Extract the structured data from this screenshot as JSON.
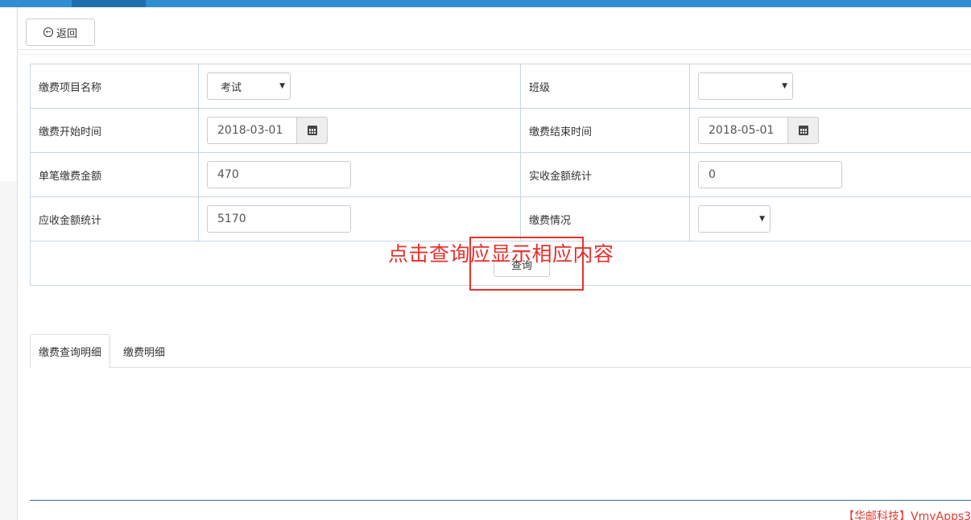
{
  "toolbar": {
    "back_label": "返回"
  },
  "form": {
    "rows": [
      {
        "label1": "缴费项目名称",
        "value1": "考试",
        "label2": "班级",
        "value2": ""
      },
      {
        "label1": "缴费开始时间",
        "value1": "2018-03-01",
        "label2": "缴费结束时间",
        "value2": "2018-05-01"
      },
      {
        "label1": "单笔缴费金额",
        "value1": "470",
        "label2": "实收金额统计",
        "value2": "0"
      },
      {
        "label1": "应收金额统计",
        "value1": "5170",
        "label2": "缴费情况",
        "value2": ""
      }
    ],
    "query_label": "查询"
  },
  "annotation": {
    "text": "点击查询应显示相应内容",
    "color": "#e8302c"
  },
  "tabs": [
    {
      "label": "缴费查询明细",
      "active": true
    },
    {
      "label": "缴费明细",
      "active": false
    }
  ],
  "footer": {
    "text": "【华邮科技】VmyApps3"
  },
  "colors": {
    "topbar": "#2f8fd0",
    "border": "#c5d6e3",
    "annotation": "#e8302c"
  }
}
